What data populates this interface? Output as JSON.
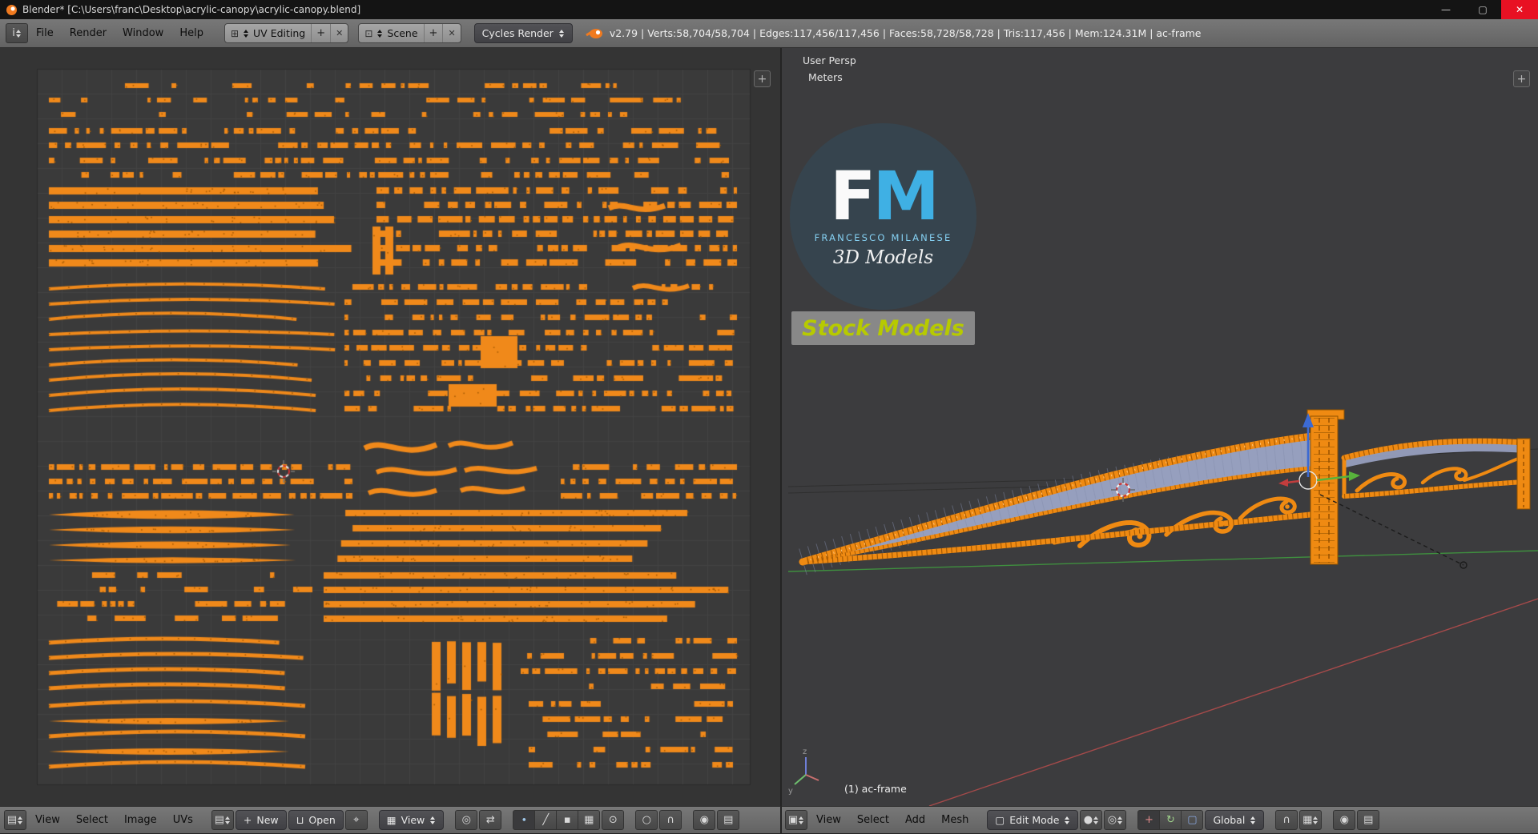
{
  "titlebar": {
    "title": "Blender* [C:\\Users\\franc\\Desktop\\acrylic-canopy\\acrylic-canopy.blend]",
    "minimize": "—",
    "maximize": "▢",
    "close": "✕"
  },
  "info_header": {
    "menus": [
      "File",
      "Render",
      "Window",
      "Help"
    ],
    "layout_value": "UV Editing",
    "scene_value": "Scene",
    "engine_value": "Cycles Render",
    "stats": "v2.79 | Verts:58,704/58,704 | Edges:117,456/117,456 | Faces:58,728/58,728 | Tris:117,456 | Mem:124.31M | ac-frame"
  },
  "uv_editor": {
    "menus": [
      "View",
      "Select",
      "Image",
      "UVs"
    ],
    "new_label": "New",
    "open_label": "Open",
    "display_label": "View",
    "canvas": {
      "outer_bg": "#343434",
      "bg": "#3a3a3a",
      "grid_line": "#434343",
      "island": "#f0891a",
      "island_dark": "#a85c04"
    }
  },
  "viewport3d": {
    "overlay": {
      "persp": "User Persp",
      "units": "Meters",
      "object": "(1) ac-frame"
    },
    "axis": {
      "z": "z",
      "y": "y"
    },
    "logo": {
      "f": "F",
      "m": "M",
      "name": "FRANCESCO MILANESE",
      "models": "3D Models",
      "banner": "Stock Models"
    },
    "menus": [
      "View",
      "Select",
      "Add",
      "Mesh"
    ],
    "mode_label": "Edit Mode",
    "orientation_label": "Global",
    "colors": {
      "frame": "#ef8a12",
      "frame_dark": "#a85c04",
      "frame_light": "#ffc173",
      "panel": "#9aa3c4",
      "panel_wire": "#848dae",
      "axis_green": "#3f8f3f",
      "axis_red": "#a54a4a",
      "arrow_blue": "#3c6ad2",
      "arrow_green": "#58b33c",
      "arrow_red": "#c23d3d"
    }
  },
  "icons": {
    "info": "i",
    "image_editor": "▤",
    "view3d_editor": "▣",
    "layout": "⊞",
    "scene": "⊡",
    "browse": "▤",
    "plus": "+",
    "folder": "⊔",
    "pin": "⌖",
    "display": "▦",
    "pivot": "◎",
    "sync": "⇄",
    "vertex_mode": "∙",
    "edge_mode": "╱",
    "face_mode": "▪",
    "island_mode": "▦",
    "sticky": "⊙",
    "proportional": "○",
    "snap": "∩",
    "snap_target": "▦",
    "render1": "◉",
    "render2": "▤",
    "cube": "▢",
    "shading": "●",
    "manip_translate": "+",
    "manip_rotate": "↻",
    "manip_scale": "▢",
    "region_add": "+"
  }
}
